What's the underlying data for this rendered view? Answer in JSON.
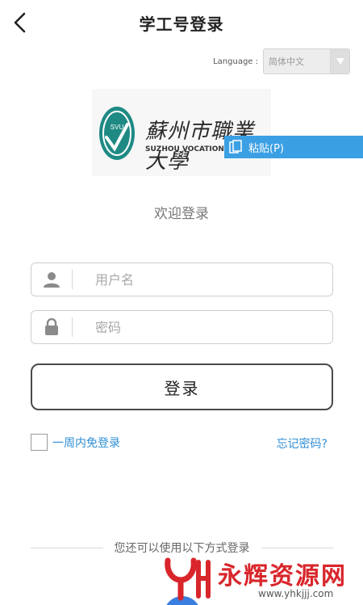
{
  "header": {
    "title": "学工号登录",
    "back_icon": "chevron-left-icon"
  },
  "language": {
    "label": "Language :",
    "selected": "简体中文",
    "arrow_icon": "triangle-down-icon"
  },
  "logo": {
    "abbr": "SVU",
    "name_cn": "蘇州市職業大學",
    "name_en": "SUZHOU VOCATIONAL U"
  },
  "context_menu": {
    "paste_label": "粘贴(P)",
    "icon": "clipboard-icon"
  },
  "welcome": "欢迎登录",
  "form": {
    "username": {
      "placeholder": "用户名",
      "value": "",
      "icon": "user-icon"
    },
    "password": {
      "placeholder": "密码",
      "value": "",
      "icon": "lock-icon"
    },
    "login_label": "登录",
    "remember_label": "一周内免登录",
    "remember_checked": false,
    "forgot_label": "忘记密码?"
  },
  "alternative": {
    "text": "您还可以使用以下方式登录"
  },
  "watermark": {
    "brand": "永辉资源网",
    "url": "www.yhkjjj.com"
  },
  "colors": {
    "link": "#2f8fd6",
    "accent": "#3b9fe4",
    "watermark": "#d8262b",
    "logo_teal": "#1f8a84"
  }
}
